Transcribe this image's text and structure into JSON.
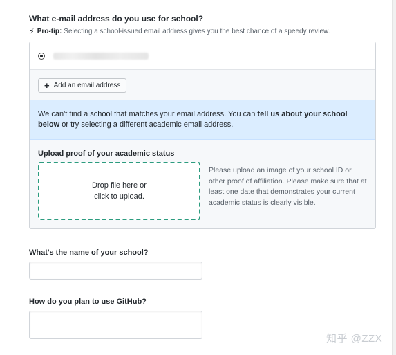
{
  "email_section": {
    "question": "What e-mail address do you use for school?",
    "protip_label": "Pro-tip:",
    "protip_text": "Selecting a school-issued email address gives you the best chance of a speedy review.",
    "add_email_label": "Add an email address"
  },
  "notice": {
    "text_before": "We can't find a school that matches your email address. You can ",
    "link_text": "tell us about your school below",
    "text_after": " or try selecting a different academic email address."
  },
  "upload": {
    "title": "Upload proof of your academic status",
    "drop_line1": "Drop file here or",
    "drop_line2": "click to upload.",
    "help_text": "Please upload an image of your school ID or other proof of affiliation. Please make sure that at least one date that demonstrates your current academic status is clearly visible."
  },
  "school_field": {
    "label": "What's the name of your school?",
    "value": ""
  },
  "usage_field": {
    "label": "How do you plan to use GitHub?",
    "value": ""
  },
  "watermark": "知乎 @ZZX",
  "colors": {
    "notice_bg": "#dbedff",
    "dropzone_border": "#2c9c7f"
  }
}
